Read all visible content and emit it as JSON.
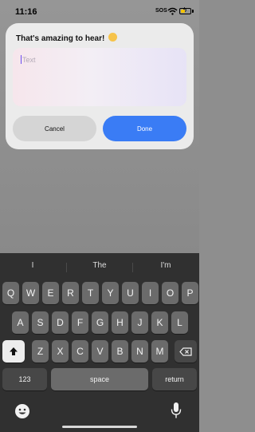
{
  "status_bar": {
    "time": "11:16",
    "sos": "SOS"
  },
  "dialog": {
    "title": "That's amazing to hear!",
    "emoji_icon": "star-struck-emoji-icon",
    "text_field": {
      "placeholder": "Text",
      "value": ""
    },
    "cancel_label": "Cancel",
    "done_label": "Done"
  },
  "keyboard": {
    "suggestions": [
      "I",
      "The",
      "I'm"
    ],
    "row1": [
      "Q",
      "W",
      "E",
      "R",
      "T",
      "Y",
      "U",
      "I",
      "O",
      "P"
    ],
    "row2": [
      "A",
      "S",
      "D",
      "F",
      "G",
      "H",
      "J",
      "K",
      "L"
    ],
    "row3": [
      "Z",
      "X",
      "C",
      "V",
      "B",
      "N",
      "M"
    ],
    "numbers_label": "123",
    "space_label": "space",
    "return_label": "return",
    "shift_icon": "shift-icon",
    "delete_icon": "delete-icon",
    "emoji_icon": "emoji-icon",
    "mic_icon": "microphone-icon"
  },
  "colors": {
    "accent": "#3a7cf5",
    "cursor": "#6b4cf0",
    "keyboard_bg": "#303030",
    "key_bg": "#6b6b6b"
  }
}
